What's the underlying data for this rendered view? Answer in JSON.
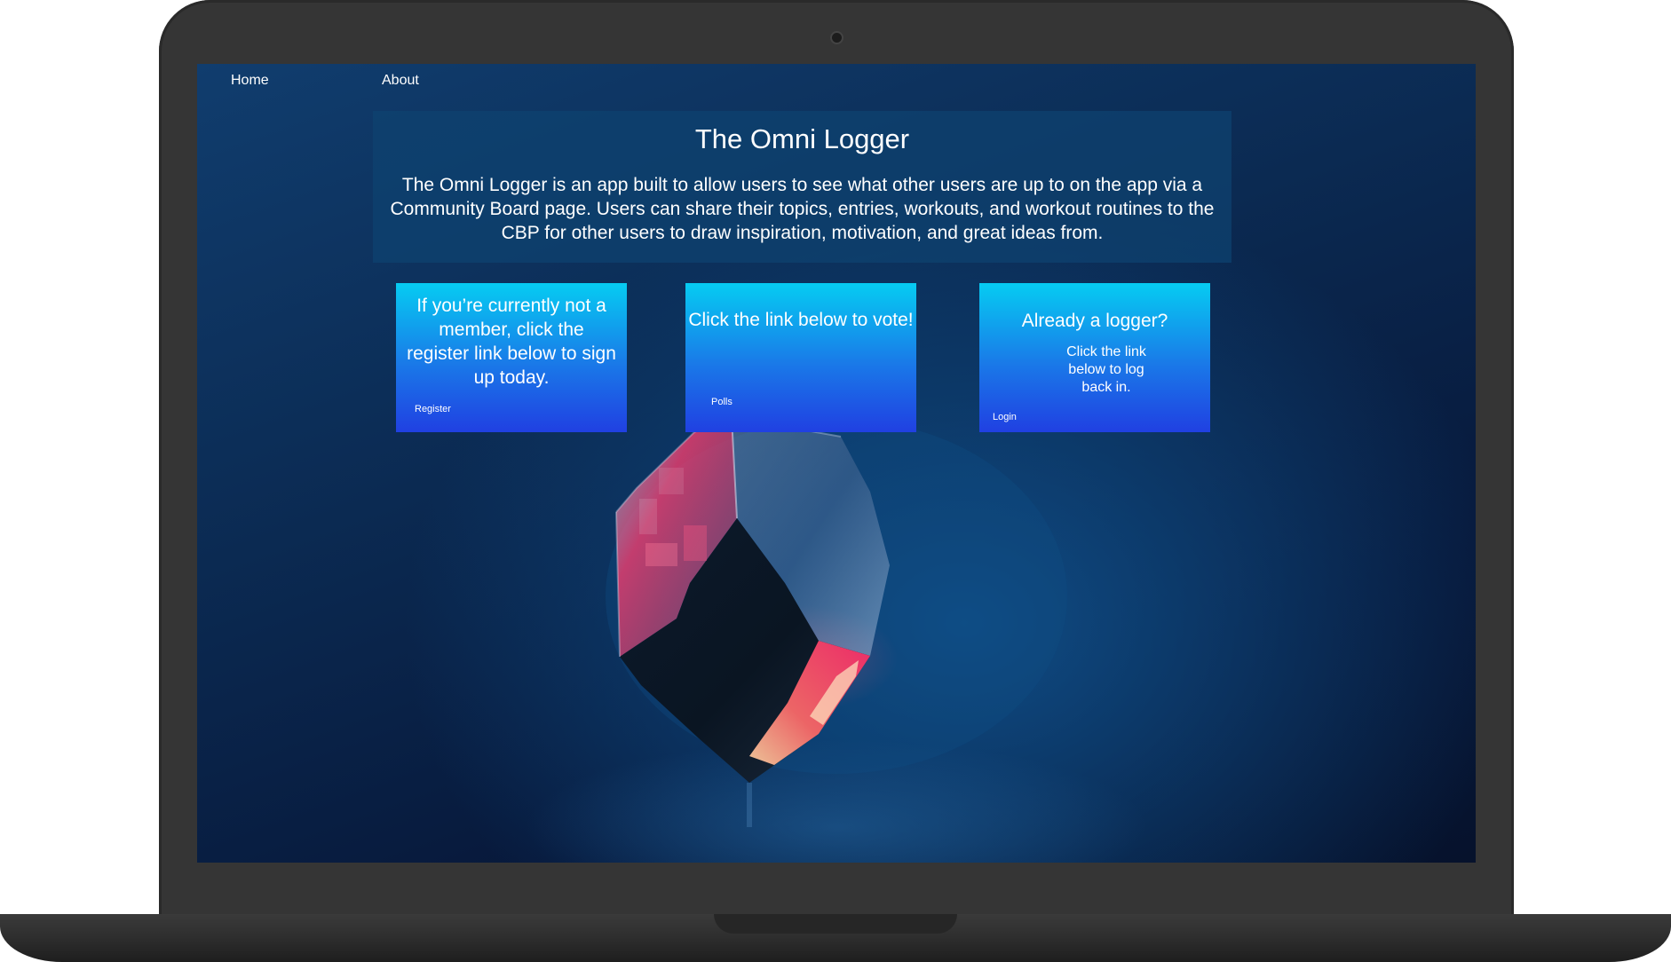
{
  "nav": {
    "home_label": "Home",
    "about_label": "About"
  },
  "hero": {
    "title": "The Omni Logger",
    "description": "The Omni Logger is an app built to allow users to see what other users are up to on the app via a Community Board page. Users can share their topics, entries, workouts, and workout routines to the CBP for other users to draw inspiration, motivation, and great ideas from."
  },
  "cards": [
    {
      "heading": "If you’re currently not a member, click the register link below to sign up today.",
      "link_label": "Register"
    },
    {
      "heading": "Click the link below to vote!",
      "link_label": "Polls"
    },
    {
      "heading": "Already a logger?",
      "subtext": "Click the link below to log back in.",
      "link_label": "Login"
    }
  ],
  "colors": {
    "laptop_frame": "#353535",
    "card_gradient_top": "#06ccf2",
    "card_gradient_bottom": "#2040e2",
    "hero_panel": "#0e4270"
  }
}
